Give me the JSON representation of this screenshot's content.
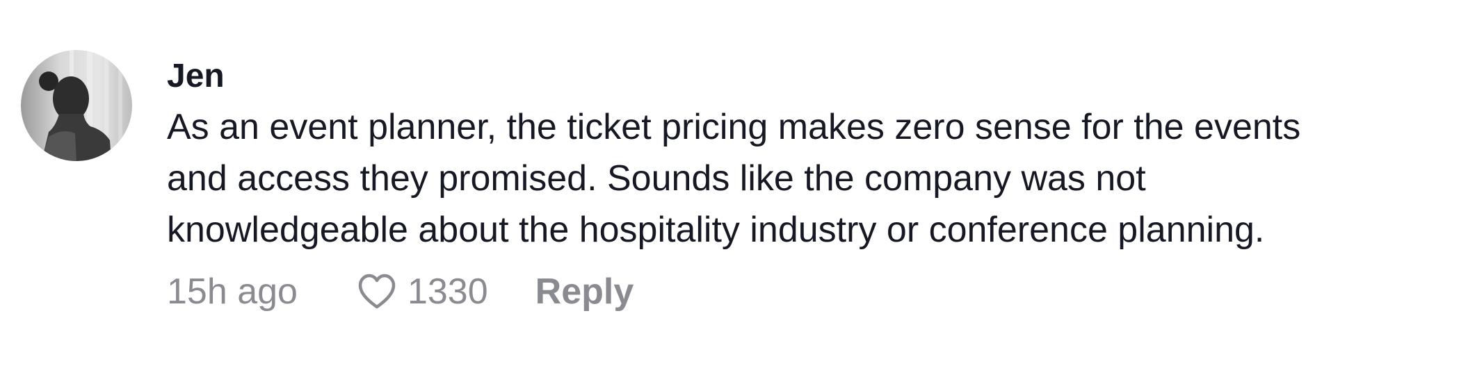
{
  "comment": {
    "username": "Jen",
    "lines": [
      "As an event planner, the ticket pricing makes zero sense for the events",
      "and access they promised. Sounds like the company was not",
      "knowledgeable about the hospitality industry or conference planning."
    ],
    "timestamp": "15h ago",
    "like_icon": "heart-outline-icon",
    "like_count": "1330",
    "reply_label": "Reply"
  },
  "colors": {
    "text": "#161823",
    "muted": "#8a8b91",
    "background": "#ffffff"
  }
}
